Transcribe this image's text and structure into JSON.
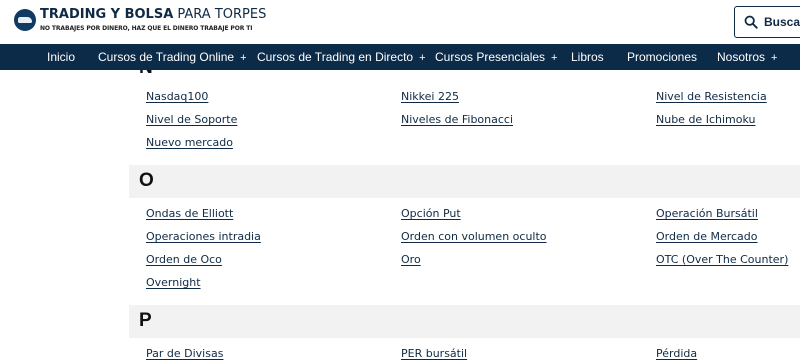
{
  "header": {
    "logo_bold": "TRADING Y BOLSA",
    "logo_thin": "PARA TORPES",
    "slogan": "NO TRABAJES POR DINERO, HAZ QUE EL DINERO TRABAJE POR TI",
    "search_label": "Buscar"
  },
  "nav": {
    "items": [
      {
        "label": "Inicio",
        "expandable": false
      },
      {
        "label": "Cursos de Trading Online",
        "expandable": true
      },
      {
        "label": "Cursos de Trading en Directo",
        "expandable": true
      },
      {
        "label": "Cursos Presenciales",
        "expandable": true
      },
      {
        "label": "Libros",
        "expandable": false
      },
      {
        "label": "Promociones",
        "expandable": false
      },
      {
        "label": "Nosotros",
        "expandable": true
      }
    ],
    "plus": "+"
  },
  "glossary": {
    "partial_letter": "N",
    "n_links": [
      "Nasdaq100",
      "Nikkei 225",
      "Nivel de Resistencia",
      "Nivel de Soporte",
      "Niveles de Fibonacci",
      "Nube de Ichimoku",
      "Nuevo mercado"
    ],
    "o_letter": "O",
    "o_links": [
      "Ondas de Elliott",
      "Opción Put",
      "Operación Bursátil",
      "Operaciones intradia",
      "Orden con volumen oculto",
      "Orden de Mercado",
      "Orden de Oco",
      "Oro",
      "OTC (Over The Counter)",
      "Overnight"
    ],
    "p_letter": "P",
    "p_links": [
      "Par de Divisas",
      "PER bursátil",
      "Pérdida"
    ]
  },
  "colors": {
    "navy": "#0c2b48",
    "link": "#0f2a44",
    "band": "#f2f2f2"
  }
}
